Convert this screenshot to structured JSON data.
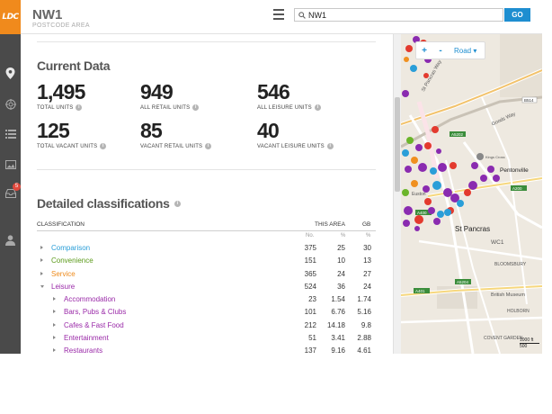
{
  "app": {
    "logo_text": "LDC"
  },
  "header": {
    "title": "NW1",
    "subtitle": "POSTCODE AREA",
    "search_value": "NW1",
    "go_label": "GO"
  },
  "sidebar": {
    "badge_count": "5"
  },
  "current_data": {
    "title": "Current Data",
    "stats": [
      {
        "value": "1,495",
        "label": "TOTAL UNITS"
      },
      {
        "value": "949",
        "label": "ALL RETAIL UNITS"
      },
      {
        "value": "546",
        "label": "ALL LEISURE UNITS"
      },
      {
        "value": "125",
        "label": "TOTAL VACANT UNITS"
      },
      {
        "value": "85",
        "label": "VACANT RETAIL UNITS"
      },
      {
        "value": "40",
        "label": "VACANT LEISURE UNITS"
      }
    ]
  },
  "classifications": {
    "title": "Detailed classifications",
    "headers": {
      "classification": "CLASSIFICATION",
      "this_area": "THIS AREA",
      "gb": "GB"
    },
    "subheaders": {
      "no": "No.",
      "pct": "%",
      "gb_pct": "%"
    },
    "rows": [
      {
        "name": "Comparison",
        "no": "375",
        "pct": "25",
        "gb": "30",
        "color": "#2a9ed8",
        "level": 0,
        "expanded": false
      },
      {
        "name": "Convenience",
        "no": "151",
        "pct": "10",
        "gb": "13",
        "color": "#5b9a1a",
        "level": 0,
        "expanded": false
      },
      {
        "name": "Service",
        "no": "365",
        "pct": "24",
        "gb": "27",
        "color": "#ee8a1a",
        "level": 0,
        "expanded": false
      },
      {
        "name": "Leisure",
        "no": "524",
        "pct": "36",
        "gb": "24",
        "color": "#9a2aa8",
        "level": 0,
        "expanded": true
      },
      {
        "name": "Accommodation",
        "no": "23",
        "pct": "1.54",
        "gb": "1.74",
        "color": "#9a2aa8",
        "level": 1,
        "expanded": false
      },
      {
        "name": "Bars, Pubs & Clubs",
        "no": "101",
        "pct": "6.76",
        "gb": "5.16",
        "color": "#9a2aa8",
        "level": 1,
        "expanded": false
      },
      {
        "name": "Cafes & Fast Food",
        "no": "212",
        "pct": "14.18",
        "gb": "9.8",
        "color": "#9a2aa8",
        "level": 1,
        "expanded": false
      },
      {
        "name": "Entertainment",
        "no": "51",
        "pct": "3.41",
        "gb": "2.88",
        "color": "#9a2aa8",
        "level": 1,
        "expanded": false
      },
      {
        "name": "Restaurants",
        "no": "137",
        "pct": "9.16",
        "gb": "4.61",
        "color": "#9a2aa8",
        "level": 1,
        "expanded": false
      }
    ]
  },
  "map": {
    "road_label": "Road",
    "zoom_in": "+",
    "zoom_out": "-",
    "labels": [
      "St Pancras Way",
      "Goods Way",
      "St Pancras",
      "Pentonville",
      "WC1",
      "BLOOMSBURY",
      "British Museum",
      "HOLBORN",
      "COVENT GARDEN",
      "A5202",
      "A200",
      "A400",
      "A5204",
      "A401",
      "B514",
      "Kings Cross",
      "Euston"
    ],
    "scale_text": "1000 ft",
    "scale_m": "500"
  }
}
